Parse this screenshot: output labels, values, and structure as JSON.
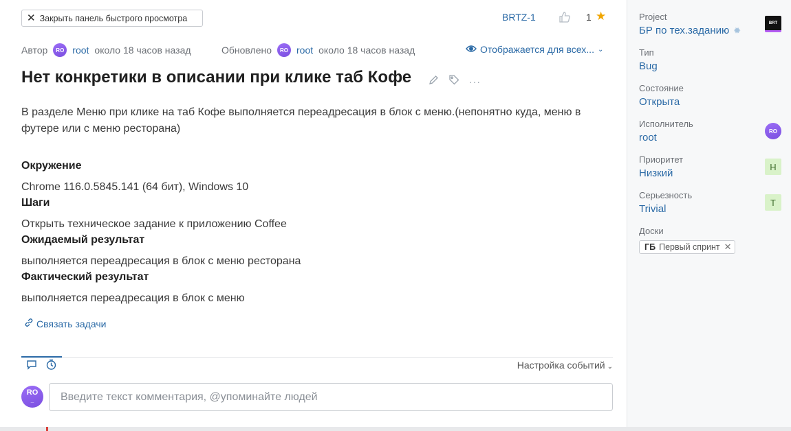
{
  "header": {
    "close_panel_label": "Закрыть панель быстрого просмотра",
    "issue_key": "BRTZ-1",
    "vote_count": "1"
  },
  "meta": {
    "author_label": "Автор",
    "author_avatar": "RO",
    "author_name": "root",
    "author_time": "около 18 часов назад",
    "updated_label": "Обновлено",
    "updated_avatar": "RO",
    "updated_name": "root",
    "updated_time": "около 18 часов назад",
    "visibility": "Отображается для всех..."
  },
  "issue": {
    "title": "Нет конкретики в описании при клике таб Кофе",
    "description": "В разделе Меню при клике на таб Кофе выполняется переадресация в блок с меню.(непонятно куда, меню в футере или с меню ресторана)",
    "env_heading": "Окружение",
    "env_text": "Chrome 116.0.5845.141 (64 бит), Windows 10",
    "steps_heading": "Шаги",
    "steps_text": "Открыть техническое задание к приложению Coffee",
    "expected_heading": "Ожидаемый результат",
    "expected_text": "выполняется переадресация в блок с меню ресторана",
    "actual_heading": "Фактический результат",
    "actual_text": "выполняется переадресация в блок с меню",
    "link_issues": "Связать задачи"
  },
  "activity": {
    "events_setting": "Настройка событий",
    "commenter_avatar": "RO",
    "comment_placeholder": "Введите текст комментария, @упоминайте людей"
  },
  "sidebar": {
    "project_label": "Project",
    "project_value": "БР по тех.заданию",
    "project_logo": "BRT",
    "type_label": "Тип",
    "type_value": "Bug",
    "state_label": "Состояние",
    "state_value": "Открыта",
    "assignee_label": "Исполнитель",
    "assignee_value": "root",
    "assignee_avatar": "RO",
    "priority_label": "Приоритет",
    "priority_value": "Низкий",
    "priority_badge": "Н",
    "severity_label": "Серьезность",
    "severity_value": "Trivial",
    "severity_badge": "T",
    "boards_label": "Доски",
    "board_short": "ГБ",
    "board_name": "Первый спринт"
  },
  "colors": {
    "accent": "#2b6aa6",
    "star": "#f0a500",
    "avatar": "#8b5cf6",
    "badge_bg": "#d9f2c9"
  },
  "icons": [
    "close-icon",
    "thumbs-up-icon",
    "star-icon",
    "eye-icon",
    "chevron-down-icon",
    "pencil-icon",
    "tag-icon",
    "more-icon",
    "link-icon",
    "comment-icon",
    "history-icon",
    "gear-icon"
  ]
}
